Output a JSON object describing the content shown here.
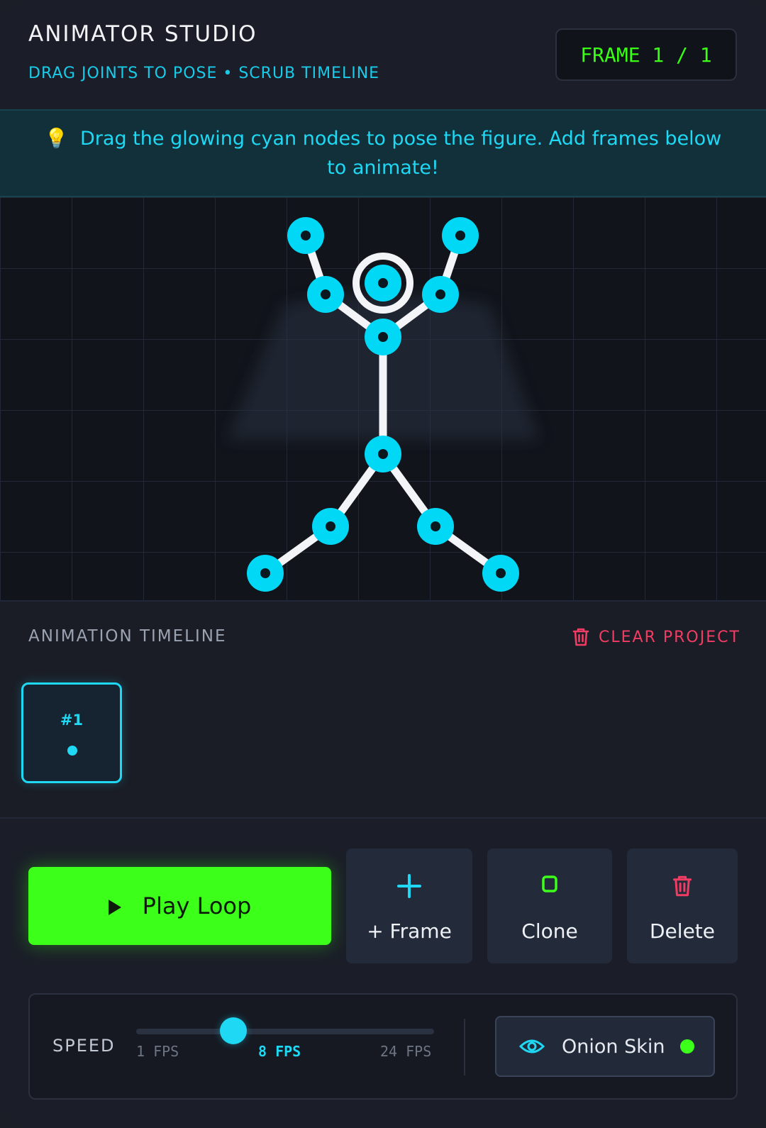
{
  "header": {
    "title": "ANIMATOR STUDIO",
    "subtitle": "DRAG JOINTS TO POSE • SCRUB TIMELINE",
    "frame_badge": "FRAME 1 / 1"
  },
  "tip": {
    "icon": "lightbulb-icon",
    "text": "Drag the glowing cyan nodes to pose the figure. Add frames below to animate!"
  },
  "timeline": {
    "label": "ANIMATION TIMELINE",
    "clear_label": "CLEAR PROJECT",
    "frames": [
      {
        "label": "#1"
      }
    ]
  },
  "controls": {
    "play_label": "Play Loop",
    "add_frame_label": "+ Frame",
    "clone_label": "Clone",
    "delete_label": "Delete",
    "speed_label": "SPEED",
    "speed_min_label": "1 FPS",
    "speed_current_label": "8 FPS",
    "speed_max_label": "24 FPS",
    "speed_value": 8,
    "speed_min": 1,
    "speed_max": 24,
    "onion_label": "Onion Skin",
    "onion_enabled": true
  },
  "colors": {
    "accent_cyan": "#1fd8f4",
    "accent_green": "#3cff1a",
    "danger": "#f13c63"
  }
}
